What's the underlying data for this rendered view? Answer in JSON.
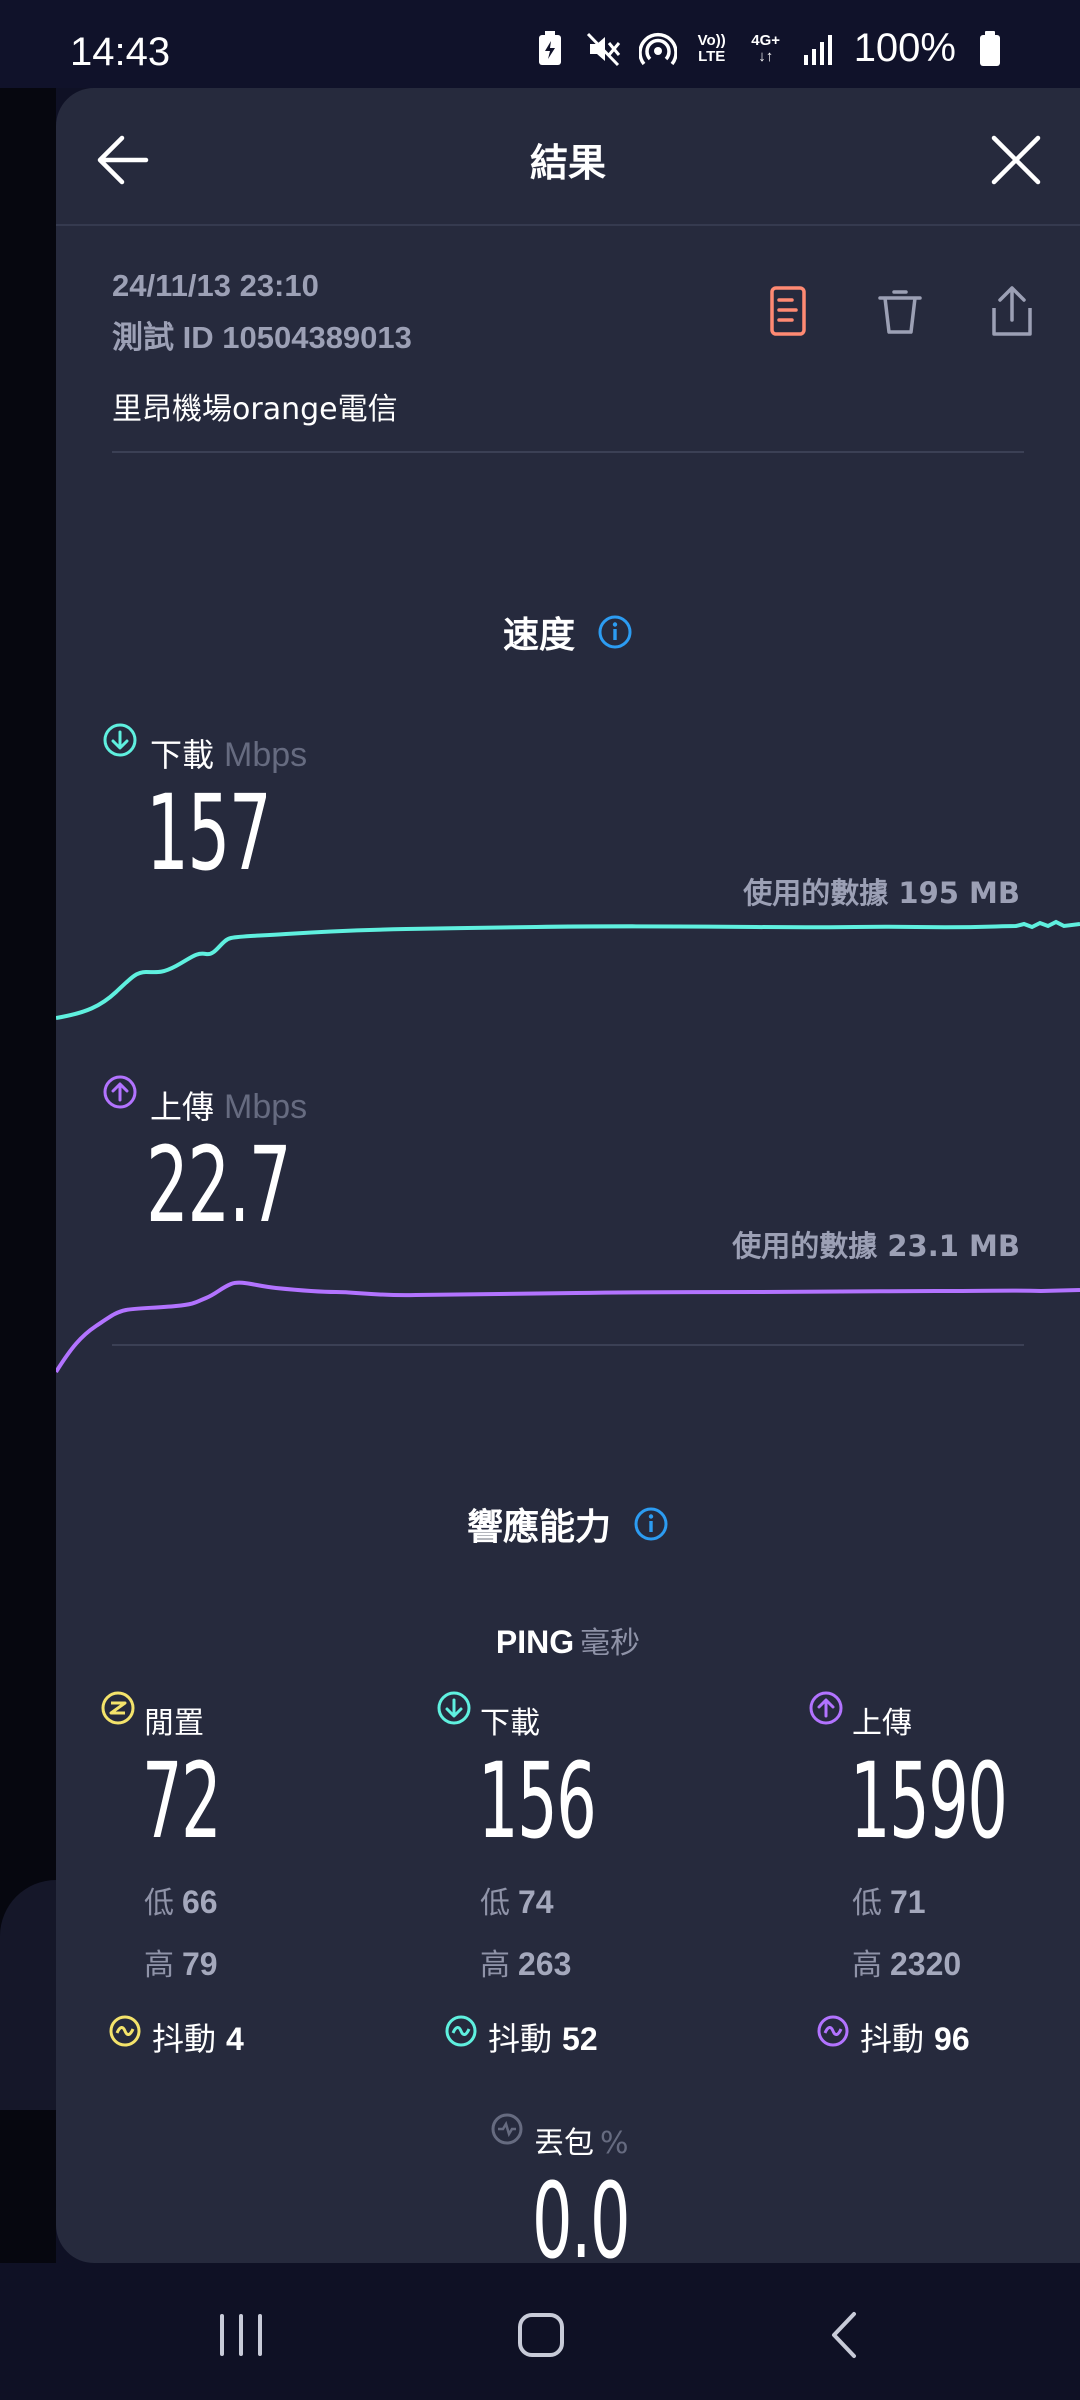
{
  "status_bar": {
    "time": "14:43",
    "battery_text": "100%",
    "net_top": "Vo))",
    "net_bottom": "LTE",
    "net2_top": "4G+",
    "net2_bottom": "↓↑"
  },
  "header": {
    "title": "結果"
  },
  "result": {
    "datetime": "24/11/13 23:10",
    "id_label": "測試 ID",
    "id_value": "10504389013",
    "server": "里昂機場orange電信"
  },
  "speed": {
    "title": "速度",
    "download": {
      "label": "下載",
      "unit": "Mbps",
      "value": "157",
      "data_used": "使用的數據 195 MB",
      "color": "#5ff0df"
    },
    "upload": {
      "label": "上傳",
      "unit": "Mbps",
      "value": "22.7",
      "data_used": "使用的數據 23.1 MB",
      "color": "#b273ff"
    }
  },
  "responsiveness": {
    "title": "響應能力",
    "ping_label": "PING",
    "ping_unit": "毫秒",
    "columns": [
      {
        "label": "閒置",
        "value": "72",
        "low_label": "低",
        "low": "66",
        "high_label": "高",
        "high": "79",
        "jitter_label": "抖動",
        "jitter": "4",
        "color": "#f4e36b"
      },
      {
        "label": "下載",
        "value": "156",
        "low_label": "低",
        "low": "74",
        "high_label": "高",
        "high": "263",
        "jitter_label": "抖動",
        "jitter": "52",
        "color": "#5ff0df"
      },
      {
        "label": "上傳",
        "value": "1590",
        "low_label": "低",
        "low": "71",
        "high_label": "高",
        "high": "2320",
        "jitter_label": "抖動",
        "jitter": "96",
        "color": "#b273ff"
      }
    ],
    "packet_loss": {
      "label": "丟包",
      "unit": "%",
      "value": "0.0"
    }
  },
  "colors": {
    "accent_info": "#2c9cf2",
    "report_icon": "#ff8a73"
  }
}
